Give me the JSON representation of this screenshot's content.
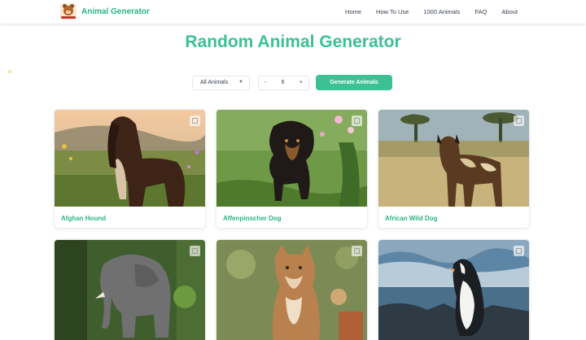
{
  "header": {
    "brand": "Animal Generator",
    "logo_icon": "animal-logo-icon",
    "nav": [
      "Home",
      "How To Use",
      "1000 Animals",
      "FAQ",
      "About"
    ]
  },
  "main": {
    "title": "Random Animal Generator",
    "controls": {
      "category_select": "All Animals",
      "quantity_value": "6",
      "minus": "-",
      "plus": "+",
      "generate_label": "Generate Animals"
    },
    "cards": [
      {
        "name": "Afghan Hound"
      },
      {
        "name": "Affenpinscher Dog"
      },
      {
        "name": "African Wild Dog"
      },
      {
        "name": ""
      },
      {
        "name": ""
      },
      {
        "name": ""
      }
    ]
  },
  "colors": {
    "accent": "#3cc194",
    "brand_text": "#2bb38a"
  }
}
